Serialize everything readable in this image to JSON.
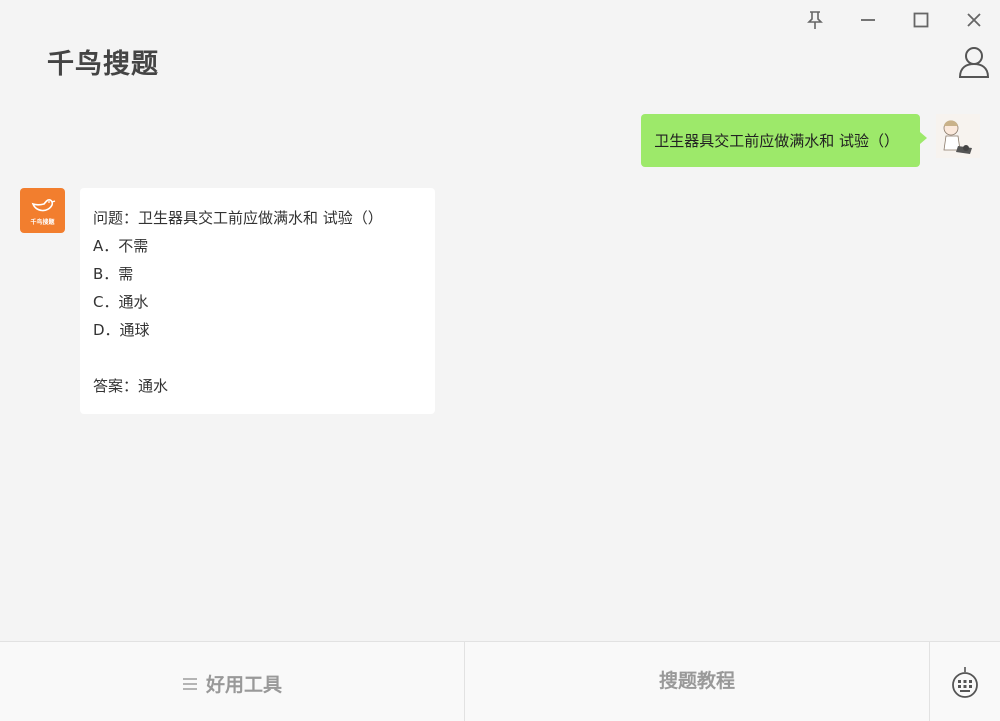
{
  "app": {
    "title": "千鸟搜题"
  },
  "window_controls": [
    "pin-icon",
    "minimize-icon",
    "maximize-icon",
    "close-icon"
  ],
  "chat": {
    "user_message": "卫生器具交工前应做满水和 试验（）",
    "bot_reply": {
      "question": "问题：卫生器具交工前应做满水和 试验（）",
      "options": [
        "A．不需",
        "B．需",
        "C．通水",
        "D．通球"
      ],
      "answer": "答案：通水"
    },
    "bot_avatar_text": "千鸟搜题"
  },
  "bottom": {
    "tools_label": "好用工具",
    "tutorial_label": "搜题教程"
  },
  "colors": {
    "user_bubble": "#9de96a",
    "bot_avatar": "#f27e2e",
    "background": "#f4f4f4"
  }
}
